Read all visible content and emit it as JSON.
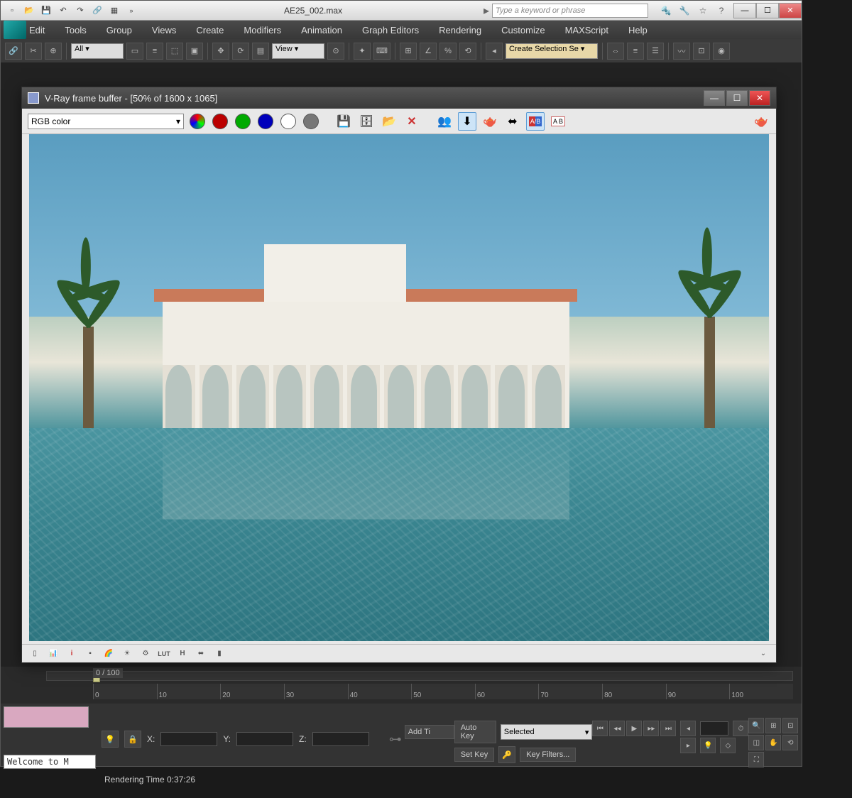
{
  "app": {
    "title": "AE25_002.max",
    "search_placeholder": "Type a keyword or phrase"
  },
  "menu": [
    "Edit",
    "Tools",
    "Group",
    "Views",
    "Create",
    "Modifiers",
    "Animation",
    "Graph Editors",
    "Rendering",
    "Customize",
    "MAXScript",
    "Help"
  ],
  "toolbar": {
    "filter_all": "All",
    "ref_coord": "View",
    "selection_set": "Create Selection Se"
  },
  "vfb": {
    "title": "V-Ray frame buffer - [50% of 1600 x 1065]",
    "channel": "RGB color",
    "bottom_labels": {
      "info": "i",
      "lut": "LUT",
      "h": "H"
    }
  },
  "timeline": {
    "frame_label": "0 / 100",
    "ticks": [
      "0",
      "10",
      "20",
      "30",
      "40",
      "50",
      "60",
      "70",
      "80",
      "90",
      "100"
    ]
  },
  "status": {
    "welcome": "Welcome to M",
    "render_time": "Rendering Time  0:37:26",
    "coords": {
      "x": "X:",
      "y": "Y:",
      "z": "Z:"
    },
    "add_time": "Add Ti",
    "auto_key": "Auto Key",
    "set_key": "Set Key",
    "key_mode": "Selected",
    "key_filters": "Key Filters..."
  }
}
